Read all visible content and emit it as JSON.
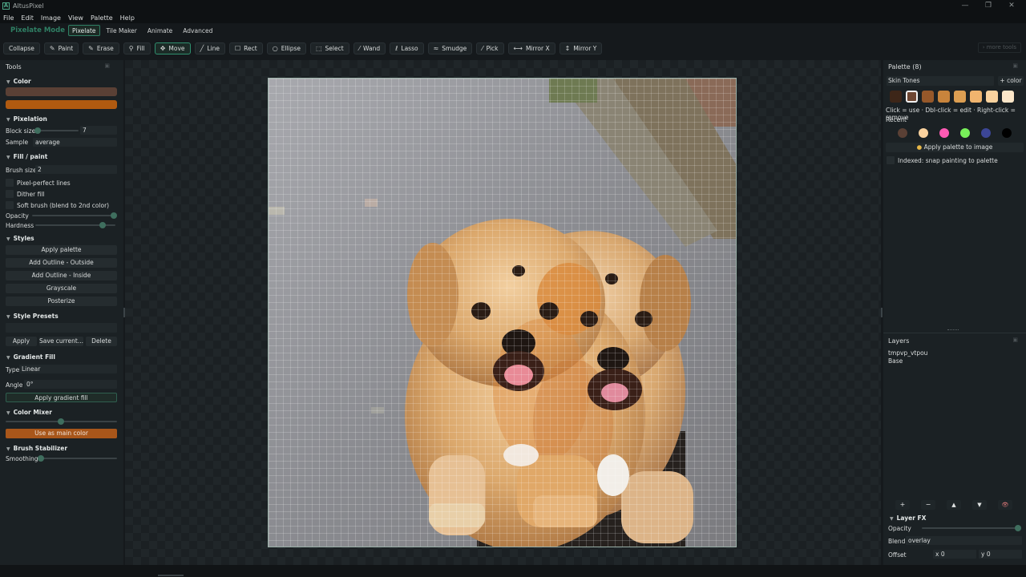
{
  "window": {
    "title": "AltusPixel",
    "minimize": "—",
    "maximize": "❐",
    "close": "✕"
  },
  "menu": [
    "File",
    "Edit",
    "Image",
    "View",
    "Palette",
    "Help"
  ],
  "mode": {
    "label": "Pixelate Mode",
    "tabs": [
      "Pixelate",
      "Tile Maker",
      "Animate",
      "Advanced"
    ],
    "active": "Pixelate"
  },
  "toolbar": {
    "collapse": "Collapse",
    "tools": [
      {
        "label": "Paint",
        "icon": "paint-brush-icon",
        "glyph": "✎"
      },
      {
        "label": "Erase",
        "icon": "eraser-icon",
        "glyph": "✎"
      },
      {
        "label": "Fill",
        "icon": "fill-bucket-icon",
        "glyph": "⚲"
      },
      {
        "label": "Move",
        "icon": "move-arrows-icon",
        "glyph": "✥",
        "active": true
      },
      {
        "label": "Line",
        "icon": "line-icon",
        "glyph": "╱"
      },
      {
        "label": "Rect",
        "icon": "rectangle-icon",
        "glyph": "☐"
      },
      {
        "label": "Ellipse",
        "icon": "ellipse-icon",
        "glyph": "○"
      },
      {
        "label": "Select",
        "icon": "select-icon",
        "glyph": "⬚"
      },
      {
        "label": "Wand",
        "icon": "wand-icon",
        "glyph": "⁄"
      },
      {
        "label": "Lasso",
        "icon": "lasso-icon",
        "glyph": "ℓ"
      },
      {
        "label": "Smudge",
        "icon": "smudge-icon",
        "glyph": "≈"
      },
      {
        "label": "Pick",
        "icon": "eyedropper-icon",
        "glyph": "⁄"
      },
      {
        "label": "Mirror X",
        "icon": "mirror-x-icon",
        "glyph": "⟷"
      },
      {
        "label": "Mirror Y",
        "icon": "mirror-y-icon",
        "glyph": "↕"
      }
    ],
    "more": "› more tools"
  },
  "tools_panel": {
    "title": "Tools",
    "color": {
      "title": "Color",
      "primary": "#5a4035",
      "secondary": "#b05a10"
    },
    "pixelation": {
      "title": "Pixelation",
      "block_size_label": "Block size",
      "block_size": "7",
      "sample_label": "Sample",
      "sample": "average"
    },
    "fill_paint": {
      "title": "Fill / paint",
      "brush_size_label": "Brush size",
      "brush_size": "2",
      "options": [
        "Pixel-perfect lines",
        "Dither fill",
        "Soft brush (blend to 2nd color)"
      ],
      "opacity_label": "Opacity",
      "hardness_label": "Hardness"
    },
    "styles": {
      "title": "Styles",
      "buttons": [
        "Apply palette",
        "Add Outline - Outside",
        "Add Outline - Inside",
        "Grayscale",
        "Posterize"
      ]
    },
    "style_presets": {
      "title": "Style Presets",
      "apply": "Apply",
      "save": "Save current...",
      "delete": "Delete"
    },
    "gradient_fill": {
      "title": "Gradient Fill",
      "type_label": "Type",
      "type": "Linear",
      "angle_label": "Angle",
      "angle": "0°",
      "apply": "Apply gradient fill"
    },
    "color_mixer": {
      "title": "Color Mixer",
      "use": "Use as main color"
    },
    "brush_stabilizer": {
      "title": "Brush Stabilizer",
      "smoothing_label": "Smoothing"
    }
  },
  "palette_panel": {
    "title": "Palette (8)",
    "palette_name": "Skin Tones",
    "add_color": "+ color",
    "swatches": [
      "#3d2618",
      "#6e4632",
      "#96582a",
      "#c8843c",
      "#dc9e52",
      "#f0b46e",
      "#fad29e",
      "#fce6c8"
    ],
    "hint": "Click = use · Dbl-click = edit · Right-click = remove",
    "recent_label": "Recent",
    "recent": [
      "#5a4035",
      "#fad29e",
      "#ff5ab4",
      "#78f05a",
      "#3c4696",
      "#000000"
    ],
    "apply": "Apply palette to image",
    "indexed": "Indexed: snap painting to palette"
  },
  "layers_panel": {
    "title": "Layers",
    "layers": [
      "tmpvp_vtpou",
      "Base"
    ],
    "buttons": [
      "+",
      "−",
      "▲",
      "▼",
      "👁"
    ],
    "fx_title": "Layer FX",
    "opacity_label": "Opacity",
    "blend_label": "Blend",
    "blend": "overlay",
    "offset_label": "Offset",
    "offset_x": "x 0",
    "offset_y": "y 0"
  }
}
